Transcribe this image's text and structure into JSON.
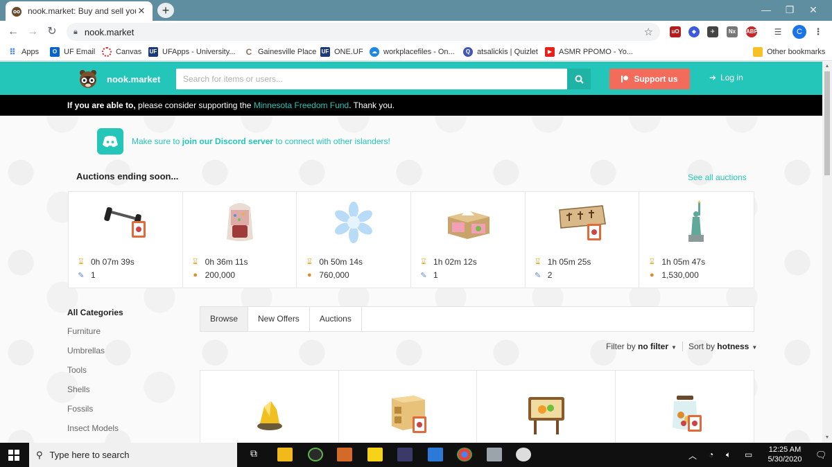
{
  "browser": {
    "tab_title": "nook.market: Buy and sell your fa",
    "new_tab": "+",
    "window_controls": {
      "minimize": "—",
      "maximize": "❐",
      "close": "✕"
    },
    "url": "nook.market",
    "bookmarks": [
      {
        "label": "Apps",
        "icon": "apps-grid-icon"
      },
      {
        "label": "UF Email",
        "icon": "outlook-icon"
      },
      {
        "label": "Canvas",
        "icon": "canvas-icon"
      },
      {
        "label": "UFApps - University...",
        "icon": "ufapps-icon"
      },
      {
        "label": "Gainesville Place",
        "icon": "gainesville-icon"
      },
      {
        "label": "ONE.UF",
        "icon": "oneuf-icon"
      },
      {
        "label": "workplacefiles - On...",
        "icon": "onedrive-icon"
      },
      {
        "label": "atsalickis | Quizlet",
        "icon": "quizlet-icon"
      },
      {
        "label": "ASMR PPOMO - Yo...",
        "icon": "youtube-icon"
      }
    ],
    "other_bookmarks": "Other bookmarks",
    "profile_initial": "C"
  },
  "site": {
    "brand": "nook.market",
    "search_placeholder": "Search for items or users...",
    "support_label": "Support us",
    "login_label": "Log in",
    "notice": {
      "bold": "If you are able to,",
      "before_link": " please consider supporting the ",
      "link": "Minnesota Freedom Fund",
      "after_link": ". Thank you."
    },
    "discord": {
      "before": "Make sure to ",
      "link": "join our Discord server",
      "after": " to connect with other islanders!"
    },
    "auctions_title": "Auctions ending soon...",
    "see_all": "See all auctions",
    "auctions": [
      {
        "time": "0h 07m 39s",
        "value": "1",
        "value_icon": "ticket-icon",
        "art": "barbell"
      },
      {
        "time": "0h 36m 11s",
        "value": "200,000",
        "value_icon": "bell-bag-icon",
        "art": "backpack"
      },
      {
        "time": "0h 50m 14s",
        "value": "760,000",
        "value_icon": "bell-bag-icon",
        "art": "snowflake"
      },
      {
        "time": "1h 02m 12s",
        "value": "1",
        "value_icon": "ticket-icon",
        "art": "tissue-box"
      },
      {
        "time": "1h 05m 25s",
        "value": "2",
        "value_icon": "ticket-icon",
        "art": "wooden-sign"
      },
      {
        "time": "1h 05m 47s",
        "value": "1,530,000",
        "value_icon": "bell-bag-icon",
        "art": "statue"
      }
    ],
    "categories_title": "All Categories",
    "categories": [
      "Furniture",
      "Umbrellas",
      "Tools",
      "Shells",
      "Fossils",
      "Insect Models"
    ],
    "tabs": [
      {
        "label": "Browse",
        "active": true
      },
      {
        "label": "New Offers",
        "active": false
      },
      {
        "label": "Auctions",
        "active": false
      }
    ],
    "filter_prefix": "Filter by ",
    "filter_value": "no filter",
    "sort_prefix": "Sort by ",
    "sort_value": "hotness"
  },
  "taskbar": {
    "search_placeholder": "Type here to search",
    "time": "12:25 AM",
    "date": "5/30/2020"
  },
  "colors": {
    "brand_teal": "#23c6b8",
    "support_red": "#f26b5b",
    "chrome_tab_bar": "#5f8ea0"
  }
}
